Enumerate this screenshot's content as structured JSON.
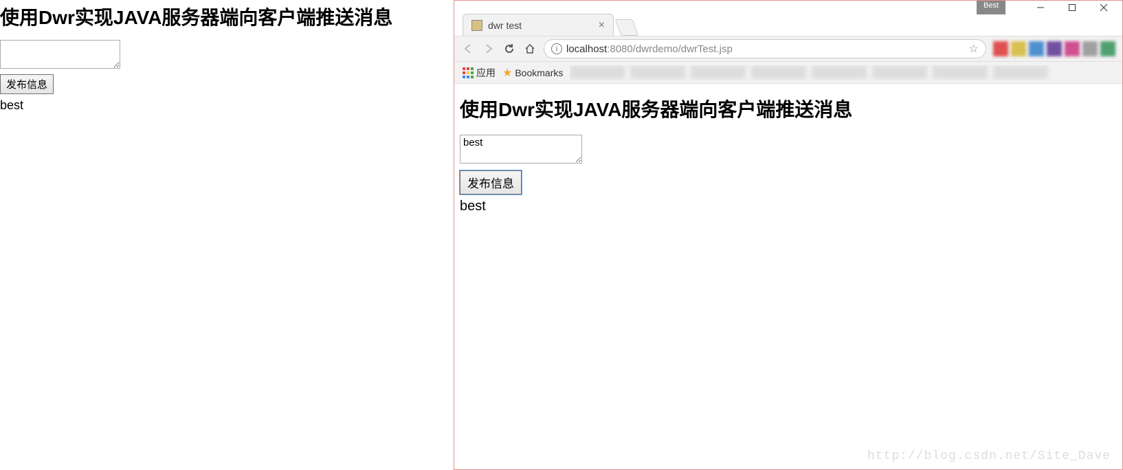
{
  "left": {
    "heading": "使用Dwr实现JAVA服务器端向客户端推送消息",
    "textarea_value": "",
    "publish_button": "发布信息",
    "output": "best"
  },
  "window": {
    "badge": "Best",
    "tab": {
      "title": "dwr test"
    },
    "address": {
      "host": "localhost",
      "port_path": ":8080/dwrdemo/dwrTest.jsp"
    },
    "bookmarks": {
      "apps_label": "应用",
      "bookmarks_label": "Bookmarks"
    },
    "page": {
      "heading": "使用Dwr实现JAVA服务器端向客户端推送消息",
      "textarea_value": "best",
      "publish_button": "发布信息",
      "output": "best"
    }
  },
  "watermark": "http://blog.csdn.net/Site_Dave"
}
